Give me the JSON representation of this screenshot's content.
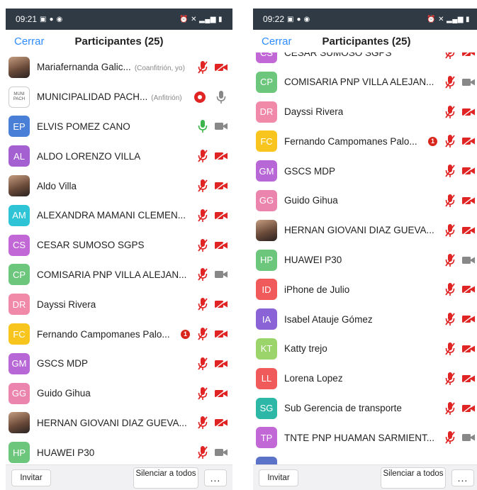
{
  "colors": {
    "accent": "#2d8cff",
    "muted_red": "#e02424",
    "unmuted_green": "#3bb54a",
    "icon_gray": "#888888"
  },
  "screens": [
    {
      "status": {
        "time": "09:21"
      },
      "header": {
        "close_label": "Cerrar",
        "title": "Participantes (25)"
      },
      "footer": {
        "invite_label": "Invitar",
        "mute_all_label": "Silenciar a todos",
        "more_label": "..."
      },
      "scroll_offset_rows": 0,
      "participants": [
        {
          "initials": "",
          "avatar": "photo",
          "name": "Mariafernanda Galic...",
          "role": "(Coanfitrión, yo)",
          "mic": "muted",
          "video": "off"
        },
        {
          "initials": "",
          "avatar": "logo",
          "logo_text": "MUNI PACH",
          "name": "MUNICIPALIDAD PACH...",
          "role": "(Anfitrión)",
          "recording": true,
          "mic": "neutral",
          "video": "none"
        },
        {
          "initials": "EP",
          "color": "#4a7fd8",
          "name": "ELVIS POMEZ CANO",
          "mic": "on",
          "video": "neutral"
        },
        {
          "initials": "AL",
          "color": "#a45fd0",
          "name": "ALDO LORENZO VILLA",
          "mic": "muted",
          "video": "off"
        },
        {
          "initials": "",
          "avatar": "photo",
          "name": "Aldo Villa",
          "mic": "muted",
          "video": "off"
        },
        {
          "initials": "AM",
          "color": "#2ec4d6",
          "name": "ALEXANDRA MAMANI CLEMEN...",
          "mic": "muted",
          "video": "off"
        },
        {
          "initials": "CS",
          "color": "#c268d6",
          "name": "CESAR SUMOSO SGPS",
          "mic": "muted",
          "video": "off"
        },
        {
          "initials": "CP",
          "color": "#6cc77c",
          "name": "COMISARIA PNP VILLA ALEJAN...",
          "mic": "muted",
          "video": "neutral"
        },
        {
          "initials": "DR",
          "color": "#f08aa8",
          "name": "Dayssi Rivera",
          "mic": "muted",
          "video": "off"
        },
        {
          "initials": "FC",
          "color": "#f7c51e",
          "name": "Fernando Campomanes Palo...",
          "badge": "1",
          "mic": "muted",
          "video": "off"
        },
        {
          "initials": "GM",
          "color": "#b768d6",
          "name": "GSCS MDP",
          "mic": "muted",
          "video": "off"
        },
        {
          "initials": "GG",
          "color": "#ec85ad",
          "name": "Guido Gihua",
          "mic": "muted",
          "video": "off"
        },
        {
          "initials": "",
          "avatar": "photo",
          "name": "HERNAN GIOVANI DIAZ GUEVA...",
          "mic": "muted",
          "video": "off"
        },
        {
          "initials": "HP",
          "color": "#6cc77c",
          "name": "HUAWEI P30",
          "mic": "muted",
          "video": "neutral"
        }
      ]
    },
    {
      "status": {
        "time": "09:22"
      },
      "header": {
        "close_label": "Cerrar",
        "title": "Participantes (25)"
      },
      "footer": {
        "invite_label": "Invitar",
        "mute_all_label": "Silenciar a todos",
        "more_label": "..."
      },
      "scroll_offset_rows": 0.5,
      "participants": [
        {
          "initials": "CS",
          "color": "#c268d6",
          "name": "CESAR SUMOSO SGPS",
          "mic": "muted",
          "video": "off"
        },
        {
          "initials": "CP",
          "color": "#6cc77c",
          "name": "COMISARIA PNP VILLA ALEJAN...",
          "mic": "muted",
          "video": "neutral"
        },
        {
          "initials": "DR",
          "color": "#f08aa8",
          "name": "Dayssi Rivera",
          "mic": "muted",
          "video": "off"
        },
        {
          "initials": "FC",
          "color": "#f7c51e",
          "name": "Fernando Campomanes Palo...",
          "badge": "1",
          "mic": "muted",
          "video": "off"
        },
        {
          "initials": "GM",
          "color": "#b768d6",
          "name": "GSCS MDP",
          "mic": "muted",
          "video": "off"
        },
        {
          "initials": "GG",
          "color": "#ec85ad",
          "name": "Guido Gihua",
          "mic": "muted",
          "video": "off"
        },
        {
          "initials": "",
          "avatar": "photo",
          "name": "HERNAN GIOVANI DIAZ GUEVA...",
          "mic": "muted",
          "video": "off"
        },
        {
          "initials": "HP",
          "color": "#6cc77c",
          "name": "HUAWEI P30",
          "mic": "muted",
          "video": "neutral"
        },
        {
          "initials": "ID",
          "color": "#f05a5a",
          "name": "iPhone de Julio",
          "mic": "muted",
          "video": "off"
        },
        {
          "initials": "IA",
          "color": "#8a64d6",
          "name": "Isabel Atauje Gómez",
          "mic": "muted",
          "video": "off"
        },
        {
          "initials": "KT",
          "color": "#9bd46a",
          "name": "Katty trejo",
          "mic": "muted",
          "video": "off"
        },
        {
          "initials": "LL",
          "color": "#f05a5a",
          "name": "Lorena Lopez",
          "mic": "muted",
          "video": "off"
        },
        {
          "initials": "SG",
          "color": "#2cb7a6",
          "name": "Sub Gerencia de transporte",
          "mic": "muted",
          "video": "off"
        },
        {
          "initials": "TP",
          "color": "#c268d6",
          "name": "TNTE PNP HUAMAN SARMIENT...",
          "mic": "muted",
          "video": "neutral"
        },
        {
          "initials": "",
          "color": "#5b72c9",
          "name": "",
          "mic": "none",
          "video": "none"
        }
      ]
    }
  ]
}
